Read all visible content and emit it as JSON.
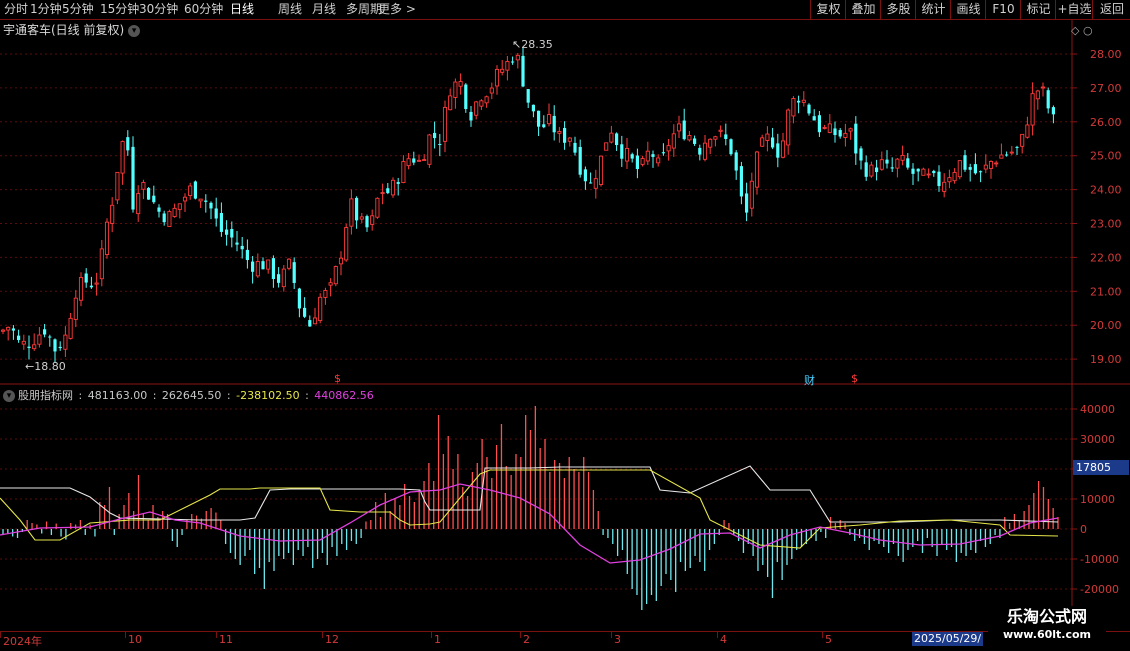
{
  "toolbar": {
    "periods": [
      "分时",
      "1分钟",
      "5分钟",
      "15分钟",
      "30分钟",
      "60分钟",
      "日线",
      "周线",
      "月线",
      "多周期",
      "更多 >"
    ],
    "active": "日线",
    "buttons": [
      "复权",
      "叠加",
      "多股",
      "统计",
      "画线",
      "F10",
      "标记",
      "+自选",
      "返回"
    ]
  },
  "stock": {
    "title": "宇通客车(日线 前复权)"
  },
  "price_axis": {
    "labels": [
      "28.00",
      "27.00",
      "26.00",
      "25.00",
      "24.00",
      "23.00",
      "22.00",
      "21.00",
      "20.00",
      "19.00"
    ]
  },
  "markers": {
    "high": "28.35",
    "low": "18.80",
    "s1": "$",
    "cai": "财",
    "s2": "$"
  },
  "indicator": {
    "name": "股朋指标网",
    "values": [
      "481163.00",
      "262645.50",
      "-238102.50",
      "440862.56"
    ],
    "value_colors": [
      "#d0d0d0",
      "#d0d0d0",
      "#e6e64a",
      "#e040e0"
    ],
    "axis": [
      "40000",
      "30000",
      "20000",
      "10000",
      "0",
      "-10000",
      "-20000"
    ],
    "last_badge": "17805"
  },
  "dates": {
    "labels": [
      "2024年",
      "10",
      "11",
      "12",
      "1",
      "2",
      "3",
      "4",
      "5"
    ],
    "highlight": "2025/05/29/"
  },
  "watermark": {
    "line1": "乐淘公式网",
    "line2": "www.60lt.com"
  },
  "chart_data": [
    {
      "type": "candlestick",
      "title": "宇通客车(日线 前复权)",
      "y_axis": [
        19,
        28
      ],
      "annotations": {
        "max": 28.35,
        "min": 18.8
      },
      "close_path": [
        [
          0,
          19.8
        ],
        [
          10,
          20.0
        ],
        [
          20,
          19.4
        ],
        [
          30,
          19.5
        ],
        [
          45,
          19.9
        ],
        [
          55,
          19.3
        ],
        [
          65,
          19.6
        ],
        [
          75,
          21.0
        ],
        [
          85,
          21.3
        ],
        [
          95,
          21.2
        ],
        [
          100,
          21.7
        ],
        [
          108,
          23.2
        ],
        [
          115,
          24.0
        ],
        [
          120,
          25.3
        ],
        [
          127,
          25.5
        ],
        [
          132,
          23.5
        ],
        [
          140,
          24.3
        ],
        [
          150,
          23.8
        ],
        [
          160,
          23.3
        ],
        [
          170,
          23.2
        ],
        [
          180,
          23.6
        ],
        [
          190,
          24.0
        ],
        [
          200,
          23.9
        ],
        [
          210,
          23.5
        ],
        [
          220,
          22.8
        ],
        [
          235,
          22.5
        ],
        [
          250,
          21.8
        ],
        [
          265,
          21.8
        ],
        [
          280,
          21.3
        ],
        [
          290,
          21.8
        ],
        [
          300,
          20.5
        ],
        [
          310,
          20.0
        ],
        [
          320,
          20.8
        ],
        [
          330,
          21.0
        ],
        [
          340,
          22.0
        ],
        [
          350,
          23.6
        ],
        [
          360,
          23.0
        ],
        [
          370,
          22.8
        ],
        [
          380,
          24.0
        ],
        [
          390,
          23.9
        ],
        [
          400,
          24.5
        ],
        [
          410,
          25.0
        ],
        [
          420,
          24.8
        ],
        [
          430,
          25.6
        ],
        [
          440,
          25.5
        ],
        [
          450,
          27.0
        ],
        [
          460,
          27.2
        ],
        [
          470,
          26.2
        ],
        [
          480,
          26.8
        ],
        [
          490,
          27.0
        ],
        [
          500,
          27.5
        ],
        [
          510,
          27.8
        ],
        [
          515,
          28.1
        ],
        [
          520,
          27.6
        ],
        [
          530,
          26.4
        ],
        [
          540,
          25.8
        ],
        [
          550,
          26.0
        ],
        [
          560,
          25.5
        ],
        [
          570,
          25.6
        ],
        [
          580,
          24.7
        ],
        [
          590,
          24.1
        ],
        [
          600,
          24.8
        ],
        [
          610,
          25.9
        ],
        [
          620,
          25.2
        ],
        [
          630,
          24.9
        ],
        [
          640,
          24.5
        ],
        [
          650,
          25.2
        ],
        [
          660,
          24.6
        ],
        [
          670,
          25.5
        ],
        [
          680,
          25.8
        ],
        [
          690,
          25.6
        ],
        [
          700,
          25.2
        ],
        [
          710,
          25.7
        ],
        [
          720,
          25.6
        ],
        [
          730,
          25.3
        ],
        [
          740,
          24.0
        ],
        [
          745,
          22.9
        ],
        [
          750,
          24.1
        ],
        [
          760,
          25.2
        ],
        [
          770,
          25.6
        ],
        [
          780,
          25.0
        ],
        [
          790,
          26.5
        ],
        [
          800,
          26.8
        ],
        [
          810,
          26.3
        ],
        [
          820,
          25.8
        ],
        [
          830,
          25.7
        ],
        [
          840,
          25.6
        ],
        [
          850,
          25.7
        ],
        [
          860,
          24.8
        ],
        [
          870,
          24.5
        ],
        [
          880,
          24.8
        ],
        [
          890,
          24.5
        ],
        [
          900,
          24.9
        ],
        [
          910,
          24.5
        ],
        [
          920,
          24.4
        ],
        [
          930,
          24.3
        ],
        [
          940,
          24.2
        ],
        [
          950,
          24.5
        ],
        [
          960,
          24.8
        ],
        [
          970,
          24.6
        ],
        [
          980,
          24.4
        ],
        [
          990,
          24.8
        ],
        [
          1000,
          25.0
        ],
        [
          1010,
          25.1
        ],
        [
          1020,
          25.2
        ],
        [
          1030,
          26.4
        ],
        [
          1035,
          27.0
        ],
        [
          1045,
          26.8
        ],
        [
          1050,
          26.2
        ],
        [
          1058,
          25.8
        ]
      ]
    },
    {
      "type": "bar",
      "series_name": "股朋指标网",
      "y_axis": [
        -25000,
        45000
      ],
      "values": [
        -2000,
        -1500,
        -2500,
        -3000,
        -1000,
        3000,
        2000,
        1500,
        -1500,
        2500,
        -2000,
        1800,
        -2500,
        -3500,
        2000,
        1500,
        3000,
        -2000,
        1500,
        -2500,
        9000,
        8000,
        14000,
        -2000,
        5000,
        8000,
        12000,
        6000,
        18000,
        5000,
        3000,
        8000,
        4000,
        6000,
        5000,
        -4000,
        -6000,
        -2000,
        3000,
        5000,
        4500,
        3500,
        6000,
        7000,
        5500,
        3000,
        -5000,
        -8000,
        -10000,
        -12000,
        -9000,
        -7000,
        -15000,
        -13000,
        -20000,
        -11000,
        -14000,
        -9000,
        -10000,
        -8000,
        -12000,
        -7000,
        -9000,
        -6000,
        -13000,
        -10000,
        -8000,
        -12000,
        -6000,
        -9000,
        -5000,
        -7000,
        -4000,
        -5000,
        -3000,
        2500,
        3000,
        9000,
        4000,
        12000,
        6000,
        10000,
        8000,
        15000,
        11000,
        9000,
        13000,
        16000,
        22000,
        16000,
        38000,
        25000,
        31000,
        20000,
        25000,
        14000,
        11000,
        19000,
        22000,
        30000,
        24000,
        17000,
        28000,
        35000,
        21000,
        18000,
        25000,
        24000,
        38000,
        33000,
        41000,
        27000,
        30000,
        19000,
        23000,
        22000,
        17000,
        24000,
        20000,
        19000,
        24000,
        19000,
        13000,
        6000,
        -2000,
        -3000,
        -5000,
        -9000,
        -7000,
        -15000,
        -20000,
        -22000,
        -27000,
        -25000,
        -22000,
        -24000,
        -19000,
        -15000,
        -17000,
        -21000,
        -11000,
        -14000,
        -13000,
        -9000,
        -11000,
        -14000,
        -7000,
        -5000,
        -2000,
        3000,
        2000,
        -2000,
        -4000,
        -8000,
        -5000,
        -9000,
        -14000,
        -12000,
        -16000,
        -23000,
        -11000,
        -17000,
        -12000,
        -10000,
        -7000,
        -6000,
        -5000,
        -3000,
        -4000,
        -1000,
        -3000,
        4000,
        2000,
        3000,
        2000,
        -2000,
        -4000,
        -3000,
        -5000,
        -7000,
        -4000,
        -5000,
        -6000,
        -8000,
        -5000,
        -9000,
        -11000,
        -7000,
        -6000,
        -4000,
        -8000,
        -3000,
        -6000,
        -9000,
        -5000,
        -7000,
        -6000,
        -11000,
        -8000,
        -9000,
        -7000,
        -8000,
        -4000,
        -6000,
        -5000,
        -2000,
        -3000,
        4000,
        2000,
        5000,
        3000,
        6000,
        8000,
        12000,
        16000,
        14000,
        10000,
        7000,
        4000
      ]
    }
  ]
}
